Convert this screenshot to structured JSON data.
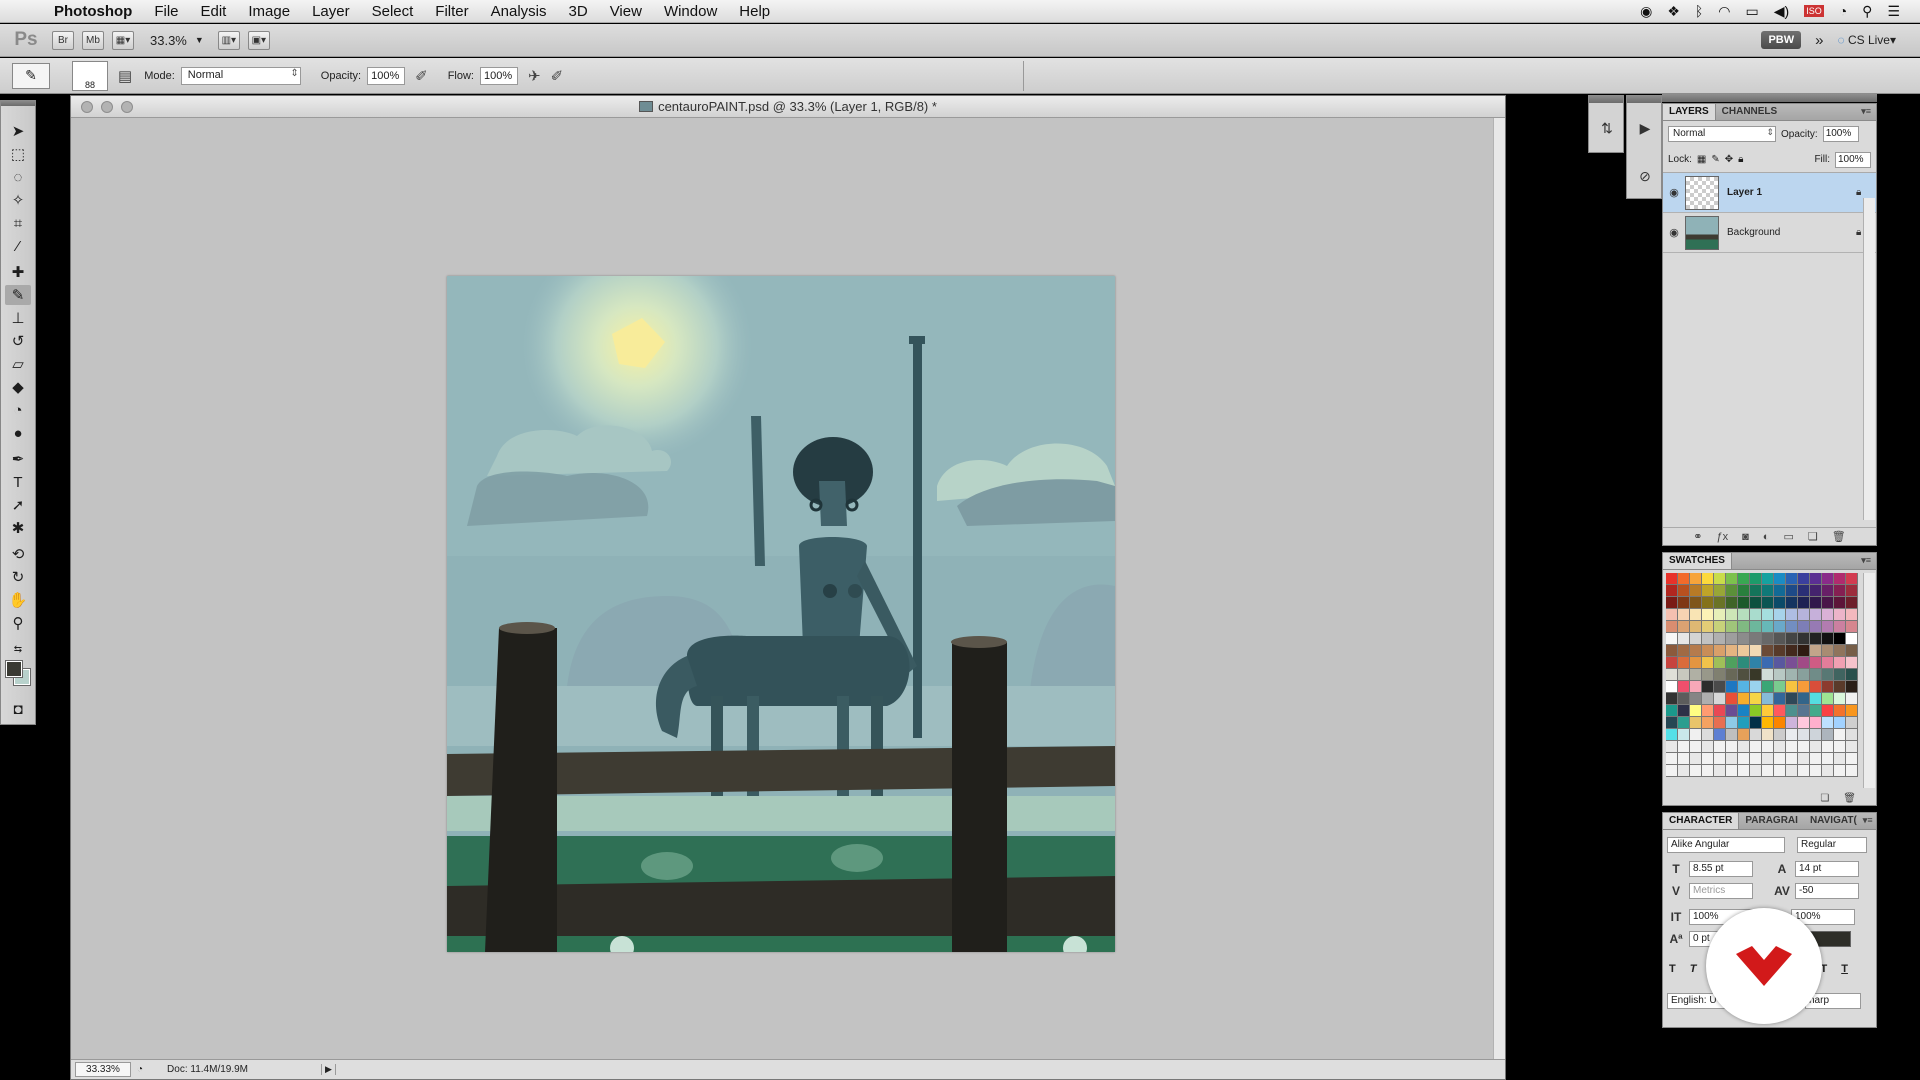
{
  "menubar": {
    "app_name": "Photoshop",
    "items": [
      "File",
      "Edit",
      "Image",
      "Layer",
      "Select",
      "Filter",
      "Analysis",
      "3D",
      "View",
      "Window",
      "Help"
    ]
  },
  "appbar": {
    "ps_logo": "Ps",
    "bridge": "Br",
    "minibridge": "Mb",
    "zoom": "33.3%",
    "pbw": "PBW",
    "cs_live": "CS Live"
  },
  "options": {
    "brush_size": "88",
    "mode_label": "Mode:",
    "mode_value": "Normal",
    "opacity_label": "Opacity:",
    "opacity_value": "100%",
    "flow_label": "Flow:",
    "flow_value": "100%"
  },
  "document": {
    "title": "centauroPAINT.psd @ 33.3% (Layer 1, RGB/8) *",
    "status_zoom": "33.33%",
    "doc_size": "Doc: 11.4M/19.9M"
  },
  "layers_panel": {
    "tabs": [
      "LAYERS",
      "CHANNELS"
    ],
    "blend_mode": "Normal",
    "opacity_label": "Opacity:",
    "opacity_value": "100%",
    "lock_label": "Lock:",
    "fill_label": "Fill:",
    "fill_value": "100%",
    "layers": [
      {
        "name": "Layer 1",
        "selected": true
      },
      {
        "name": "Background",
        "selected": false
      }
    ]
  },
  "swatches_panel": {
    "tabs": [
      "SWATCHES"
    ]
  },
  "character_panel": {
    "tabs": [
      "CHARACTER",
      "PARAGRAI",
      "NAVIGAT("
    ],
    "font_family": "Alike Angular",
    "font_style": "Regular",
    "font_size": "8.55 pt",
    "leading": "14 pt",
    "kerning": "Metrics",
    "tracking": "-50",
    "vertical_scale": "100%",
    "horizontal_scale": "100%",
    "baseline_shift": "0 pt",
    "language": "English: U",
    "antialias": "harp"
  },
  "colors": {
    "selection": "#bcd6ef",
    "foreground": "#3a3a33",
    "background": "#b8d2cc",
    "logo_red": "#d2191a"
  }
}
